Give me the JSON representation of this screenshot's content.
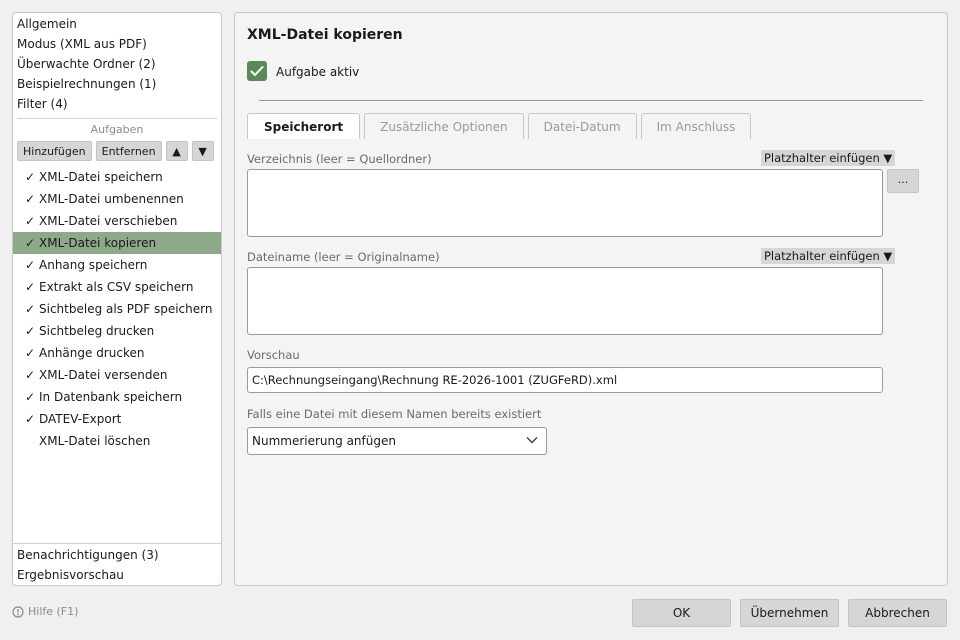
{
  "sidebar": {
    "top_items": [
      {
        "label": "Allgemein"
      },
      {
        "label": "Modus (XML aus PDF)"
      },
      {
        "label": "Überwachte Ordner (2)"
      },
      {
        "label": "Beispielrechnungen (1)"
      },
      {
        "label": "Filter (4)"
      }
    ],
    "tasks_heading": "Aufgaben",
    "buttons": {
      "add": "Hinzufügen",
      "remove": "Entfernen",
      "up": "▲",
      "down": "▼"
    },
    "tasks": [
      {
        "check": "✓",
        "label": "XML-Datei speichern"
      },
      {
        "check": "✓",
        "label": "XML-Datei umbenennen"
      },
      {
        "check": "✓",
        "label": "XML-Datei verschieben"
      },
      {
        "check": "✓",
        "label": "XML-Datei kopieren",
        "selected": true
      },
      {
        "check": "✓",
        "label": "Anhang speichern"
      },
      {
        "check": "✓",
        "label": "Extrakt als CSV speichern"
      },
      {
        "check": "✓",
        "label": "Sichtbeleg als PDF speichern"
      },
      {
        "check": "✓",
        "label": "Sichtbeleg drucken"
      },
      {
        "check": "✓",
        "label": "Anhänge drucken"
      },
      {
        "check": "✓",
        "label": "XML-Datei versenden"
      },
      {
        "check": "✓",
        "label": "In Datenbank speichern"
      },
      {
        "check": "✓",
        "label": "DATEV-Export"
      },
      {
        "check": "",
        "label": "XML-Datei löschen"
      }
    ],
    "bottom_items": [
      {
        "label": "Benachrichtigungen (3)"
      },
      {
        "label": "Ergebnisvorschau"
      }
    ],
    "selected_color": "#8ea88a"
  },
  "main": {
    "title": "XML-Datei kopieren",
    "active_checkbox": {
      "label": "Aufgabe aktiv",
      "checked": true,
      "color": "#5b8a58"
    },
    "tabs": [
      {
        "label": "Speicherort",
        "active": true
      },
      {
        "label": "Zusätzliche Optionen"
      },
      {
        "label": "Datei-Datum"
      },
      {
        "label": "Im Anschluss"
      }
    ],
    "directory": {
      "label": "Verzeichnis (leer = Quellordner)",
      "placeholder_button": "Platzhalter einfügen ▼",
      "value": "",
      "browse_label": "..."
    },
    "filename": {
      "label": "Dateiname (leer = Originalname)",
      "placeholder_button": "Platzhalter einfügen ▼",
      "value": ""
    },
    "preview": {
      "label": "Vorschau",
      "value": "C:\\Rechnungseingang\\Rechnung RE-2026-1001 (ZUGFeRD).xml"
    },
    "exists": {
      "label": "Falls eine Datei mit diesem Namen bereits existiert",
      "selected": "Nummerierung anfügen"
    }
  },
  "footer": {
    "help": "Hilfe (F1)",
    "ok": "OK",
    "apply": "Übernehmen",
    "cancel": "Abbrechen"
  }
}
